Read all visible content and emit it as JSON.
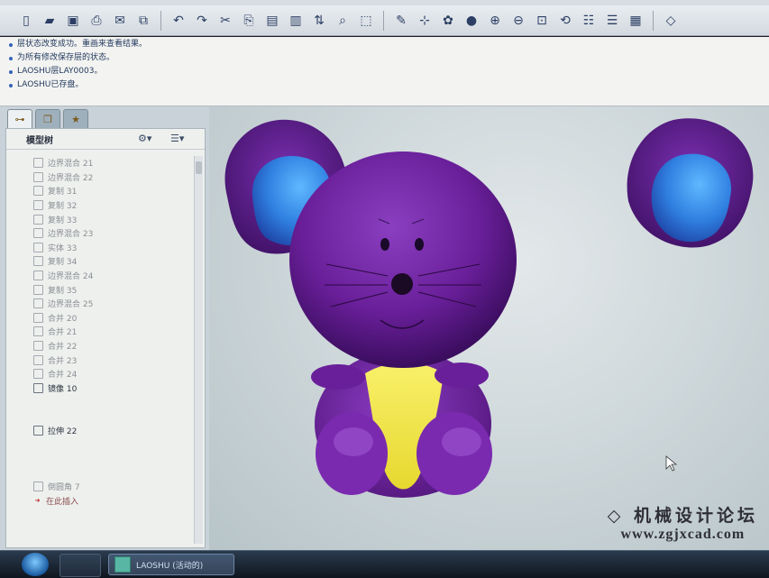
{
  "messages": [
    "层状态改变成功。重画来查看结果。",
    "为所有修改保存层的状态。",
    "LAOSHU层LAY0003。",
    "LAOSHU已存盘。"
  ],
  "toolbar": {
    "icons": [
      "new-icon",
      "open-icon",
      "save-icon",
      "print-icon",
      "email-icon",
      "copy-file-icon",
      "undo-icon",
      "redo-icon",
      "cut-icon",
      "copy-icon",
      "paste-icon",
      "paste-special-icon",
      "regenerate-icon",
      "find-icon",
      "select-box-icon",
      "sketch-icon",
      "datum-icon",
      "appearance-icon",
      "shading-icon",
      "zoom-in-icon",
      "zoom-out-icon",
      "refit-icon",
      "orient-icon",
      "named-views-icon",
      "layers-icon",
      "view-manager-icon",
      "plane-display-icon"
    ]
  },
  "navigator": {
    "tabs": [
      "model-tree-tab",
      "folder-browser-tab",
      "favorites-tab"
    ],
    "title": "模型树",
    "items": [
      {
        "label": "边界混合 21",
        "state": "suppressed"
      },
      {
        "label": "边界混合 22",
        "state": "suppressed"
      },
      {
        "label": "复制 31",
        "state": "suppressed"
      },
      {
        "label": "复制 32",
        "state": "suppressed"
      },
      {
        "label": "复制 33",
        "state": "suppressed"
      },
      {
        "label": "边界混合 23",
        "state": "suppressed"
      },
      {
        "label": "实体 33",
        "state": "suppressed"
      },
      {
        "label": "复制 34",
        "state": "suppressed"
      },
      {
        "label": "边界混合 24",
        "state": "suppressed"
      },
      {
        "label": "复制 35",
        "state": "suppressed"
      },
      {
        "label": "边界混合 25",
        "state": "suppressed"
      },
      {
        "label": "合并 20",
        "state": "suppressed"
      },
      {
        "label": "合并 21",
        "state": "suppressed"
      },
      {
        "label": "合并 22",
        "state": "suppressed"
      },
      {
        "label": "合并 23",
        "state": "suppressed"
      },
      {
        "label": "合并 24",
        "state": "suppressed"
      },
      {
        "label": "镜像 10",
        "state": "active"
      },
      {
        "label": "",
        "state": "blank"
      },
      {
        "label": "",
        "state": "blank"
      },
      {
        "label": "拉伸 22",
        "state": "active"
      },
      {
        "label": "",
        "state": "blank"
      },
      {
        "label": "",
        "state": "blank"
      },
      {
        "label": "",
        "state": "blank"
      },
      {
        "label": "倒圆角 7",
        "state": "suppressed"
      },
      {
        "label": "在此插入",
        "state": "insert"
      }
    ]
  },
  "model": {
    "name": "LAOSHU",
    "body_color": "#6a1f9a",
    "ear_inner_color": "#2f7fe0",
    "belly_color": "#f3e84a"
  },
  "watermark": {
    "line1": "机械设计论坛",
    "line2": "www.zgjxcad.com"
  },
  "taskbar": {
    "task_label": "LAOSHU (活动的)"
  }
}
